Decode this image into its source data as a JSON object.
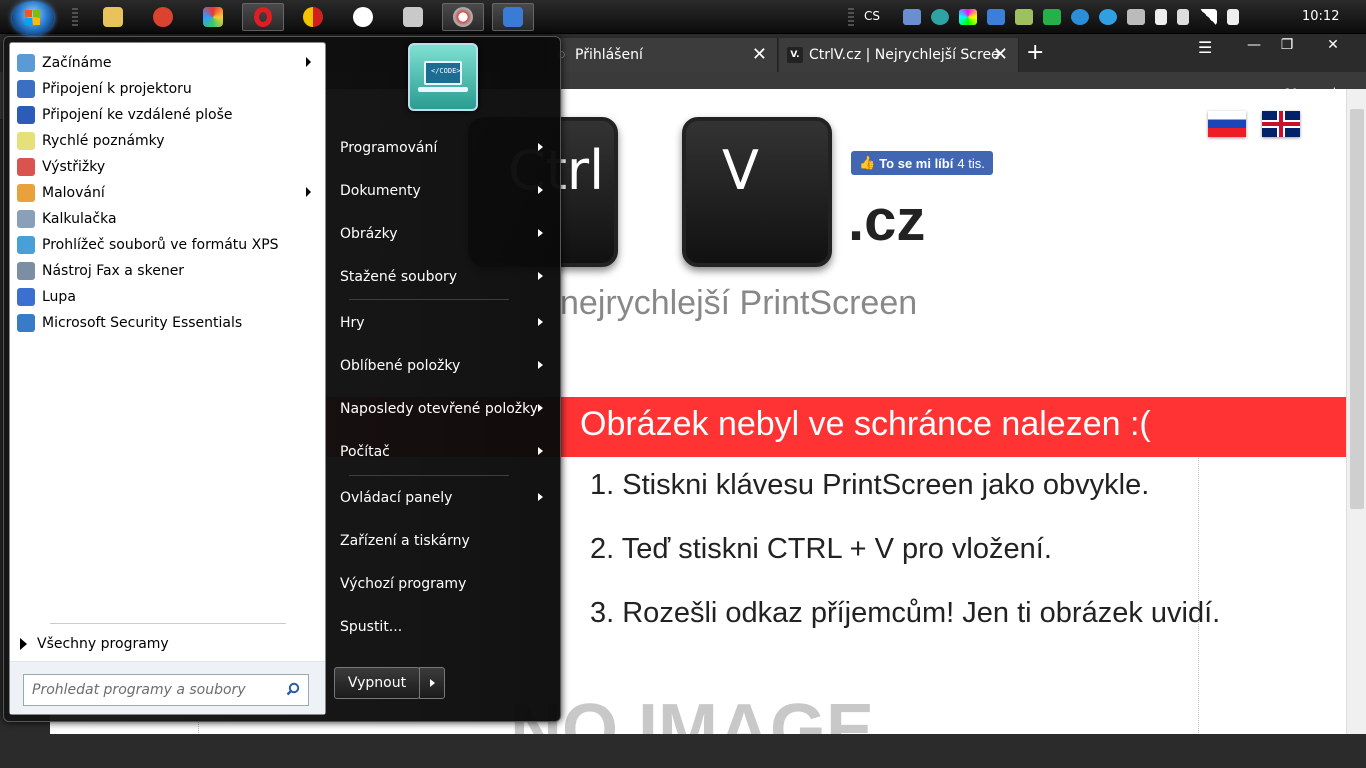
{
  "taskbar": {
    "language": "CS",
    "clock": "10:12"
  },
  "browser": {
    "tabs": [
      {
        "title": "Přihlášení",
        "favicon_label": ""
      },
      {
        "title": "CtrlV.cz | Nejrychlejší Scree",
        "favicon_label": "V."
      }
    ],
    "window_controls": {
      "minimize": "—",
      "maximize": "❐",
      "close": "✕"
    },
    "close_tab_glyph": "✕",
    "new_tab_glyph": "+",
    "heart_glyph": "♡",
    "download_glyph": "⤓"
  },
  "page": {
    "key1": "Ctrl",
    "key2": "V",
    "domain": ".cz",
    "tagline": "nejrychlejší PrintScreen",
    "fb_like": "To se mi líbí",
    "fb_count": "4 tis.",
    "banner": "Obrázek nebyl ve schránce nalezen :(",
    "step1": "1. Stiskni klávesu PrintScreen jako obvykle.",
    "step2": "2. Teď stiskni CTRL + V pro vložení.",
    "step3": "3. Rozešli odkaz příjemcům! Jen ti obrázek uvidí.",
    "noimage": "NO IMAGE"
  },
  "startmenu": {
    "programs": [
      {
        "label": "Začínáme",
        "icon": "getting-started-icon",
        "submenu": true,
        "color": "#5b9bd5"
      },
      {
        "label": "Připojení k projektoru",
        "icon": "projector-icon",
        "submenu": false,
        "color": "#3a6fc4"
      },
      {
        "label": "Připojení ke vzdálené ploše",
        "icon": "remote-desktop-icon",
        "submenu": false,
        "color": "#2d5bb8"
      },
      {
        "label": "Rychlé poznámky",
        "icon": "sticky-notes-icon",
        "submenu": false,
        "color": "#e5e07a"
      },
      {
        "label": "Výstřižky",
        "icon": "snipping-tool-icon",
        "submenu": false,
        "color": "#d9534f"
      },
      {
        "label": "Malování",
        "icon": "paint-icon",
        "submenu": true,
        "color": "#e9a23b"
      },
      {
        "label": "Kalkulačka",
        "icon": "calculator-icon",
        "submenu": false,
        "color": "#8aa0b8"
      },
      {
        "label": "Prohlížeč souborů ve formátu XPS",
        "icon": "xps-viewer-icon",
        "submenu": false,
        "color": "#47a0d8"
      },
      {
        "label": "Nástroj Fax a skener",
        "icon": "fax-scanner-icon",
        "submenu": false,
        "color": "#7b8ea3"
      },
      {
        "label": "Lupa",
        "icon": "magnifier-icon",
        "submenu": false,
        "color": "#3b6fd0"
      },
      {
        "label": "Microsoft Security Essentials",
        "icon": "security-essentials-icon",
        "submenu": false,
        "color": "#3a7bc8"
      }
    ],
    "all_programs": "Všechny programy",
    "search_placeholder": "Prohledat programy a soubory",
    "right_items": [
      {
        "label": "Programování",
        "submenu": true
      },
      {
        "label": "Dokumenty",
        "submenu": true
      },
      {
        "label": "Obrázky",
        "submenu": true
      },
      {
        "label": "Stažené soubory",
        "submenu": true
      },
      {
        "label": "Hry",
        "submenu": true
      },
      {
        "label": "Oblíbené položky",
        "submenu": true
      },
      {
        "label": "Naposledy otevřené položky",
        "submenu": true
      },
      {
        "label": "Počítač",
        "submenu": true
      },
      {
        "label": "Ovládací panely",
        "submenu": true
      },
      {
        "label": "Zařízení a tiskárny",
        "submenu": false
      },
      {
        "label": "Výchozí programy",
        "submenu": false
      },
      {
        "label": "Spustit...",
        "submenu": false
      }
    ],
    "avatar_text": "</CODE>",
    "shutdown": "Vypnout"
  }
}
